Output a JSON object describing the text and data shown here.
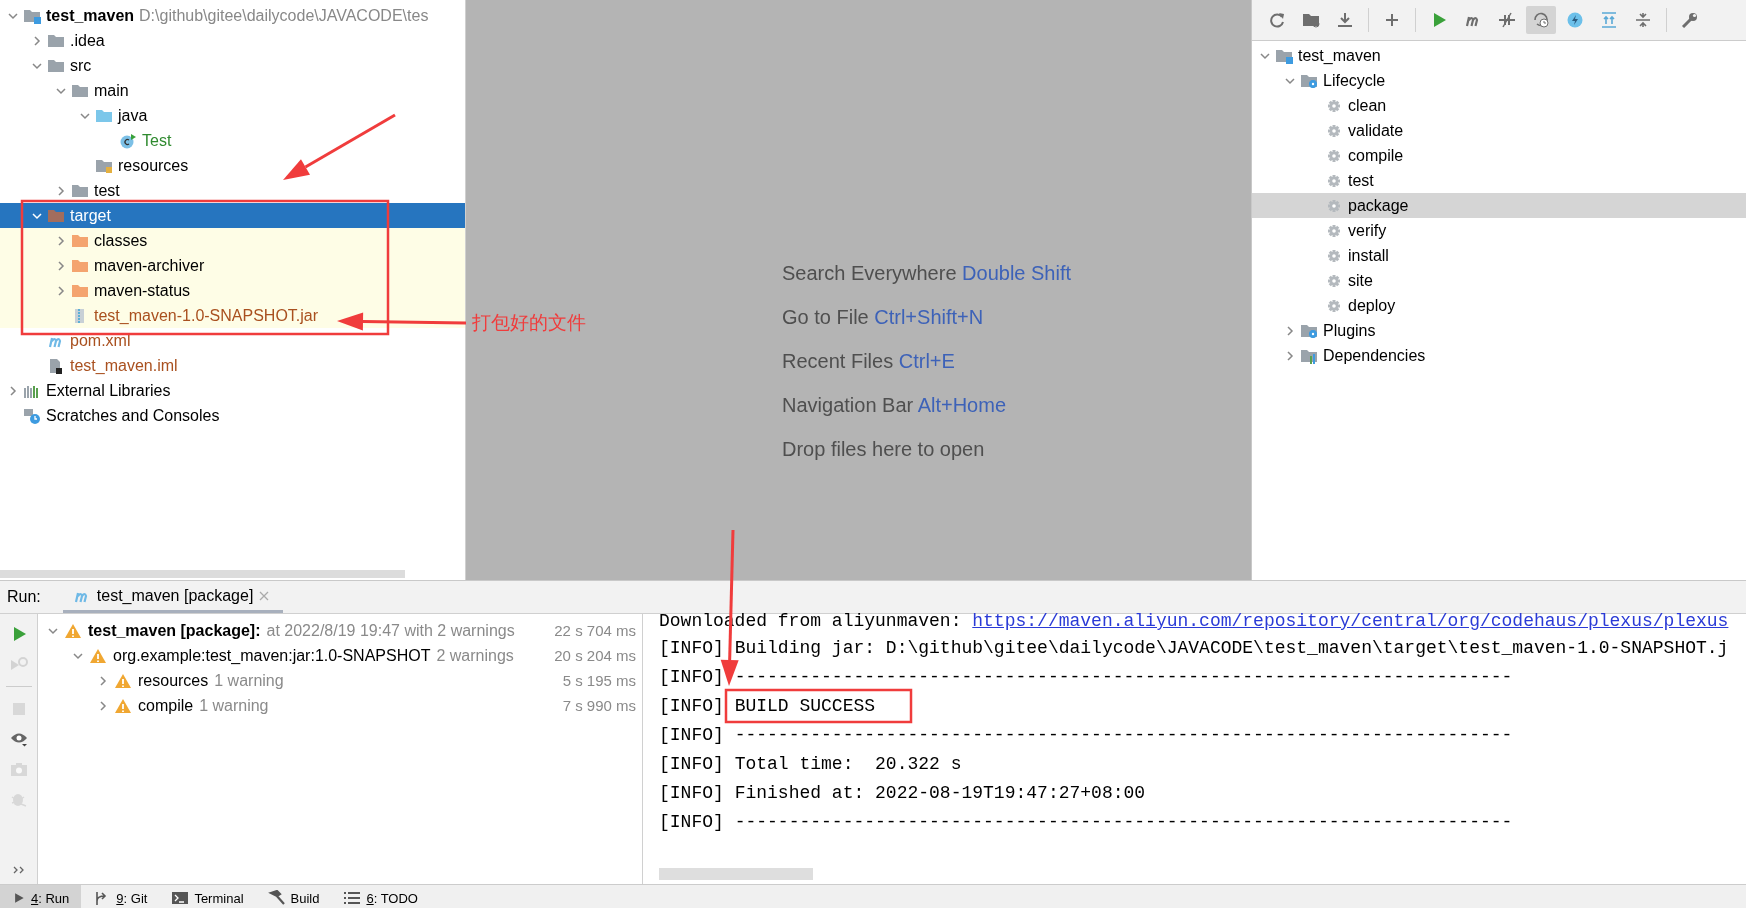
{
  "project_tree": [
    {
      "label": "test_maven",
      "path": "D:\\github\\gitee\\dailycode\\JAVACODE\\tes",
      "kind": "module",
      "expanded": true,
      "selected": false,
      "highlighted": false,
      "children": [
        {
          "label": ".idea",
          "kind": "folder",
          "expanded": false,
          "selected": false,
          "highlighted": false
        },
        {
          "label": "src",
          "kind": "folder",
          "expanded": true,
          "selected": false,
          "highlighted": false,
          "children": [
            {
              "label": "main",
              "kind": "folder",
              "expanded": true,
              "selected": false,
              "highlighted": false,
              "children": [
                {
                  "label": "java",
                  "kind": "source-folder",
                  "expanded": true,
                  "selected": false,
                  "highlighted": false,
                  "children": [
                    {
                      "label": "Test",
                      "kind": "class",
                      "selected": false,
                      "highlighted": false,
                      "color": "#2f8a2f"
                    }
                  ]
                },
                {
                  "label": "resources",
                  "kind": "resources-folder",
                  "selected": false,
                  "highlighted": false
                }
              ]
            },
            {
              "label": "test",
              "kind": "folder",
              "expanded": false,
              "selected": false,
              "highlighted": false
            }
          ]
        },
        {
          "label": "target",
          "kind": "excluded-folder",
          "expanded": true,
          "selected": true,
          "children": [
            {
              "label": "classes",
              "kind": "generated-folder",
              "expanded": false,
              "selected": false,
              "highlighted": true
            },
            {
              "label": "maven-archiver",
              "kind": "generated-folder",
              "expanded": false,
              "selected": false,
              "highlighted": true
            },
            {
              "label": "maven-status",
              "kind": "generated-folder",
              "expanded": false,
              "selected": false,
              "highlighted": true
            },
            {
              "label": "test_maven-1.0-SNAPSHOT.jar",
              "kind": "jar",
              "selected": false,
              "highlighted": true,
              "color": "#a9501f"
            }
          ]
        },
        {
          "label": "pom.xml",
          "kind": "maven-file",
          "selected": false,
          "highlighted": false,
          "color": "#a9501f"
        },
        {
          "label": "test_maven.iml",
          "kind": "module-file",
          "selected": false,
          "highlighted": false,
          "color": "#a9501f"
        }
      ]
    },
    {
      "label": "External Libraries",
      "kind": "libraries",
      "expanded": false,
      "selected": false,
      "highlighted": false
    },
    {
      "label": "Scratches and Consoles",
      "kind": "scratches",
      "selected": false,
      "highlighted": false
    }
  ],
  "annotation": {
    "note": "打包好的文件"
  },
  "welcome_hints": [
    {
      "label": "Search Everywhere",
      "shortcut": "Double Shift"
    },
    {
      "label": "Go to File",
      "shortcut": "Ctrl+Shift+N"
    },
    {
      "label": "Recent Files",
      "shortcut": "Ctrl+E"
    },
    {
      "label": "Navigation Bar",
      "shortcut": "Alt+Home"
    },
    {
      "label": "Drop files here to open"
    }
  ],
  "maven_toolbar": [
    {
      "kind": "reload",
      "on": false
    },
    {
      "kind": "folder-reload",
      "on": false
    },
    {
      "kind": "download",
      "on": false
    },
    {
      "kind": "sep"
    },
    {
      "kind": "add",
      "on": false
    },
    {
      "kind": "sep"
    },
    {
      "kind": "run",
      "on": false
    },
    {
      "kind": "maven",
      "on": false
    },
    {
      "kind": "skip-tests",
      "on": false
    },
    {
      "kind": "history",
      "on": true
    },
    {
      "kind": "lightning",
      "on": false
    },
    {
      "kind": "expand-all",
      "on": false
    },
    {
      "kind": "collapse-all",
      "on": false
    },
    {
      "kind": "sep"
    },
    {
      "kind": "wrench",
      "on": false
    }
  ],
  "maven_tree": [
    {
      "label": "test_maven",
      "kind": "module",
      "expanded": true,
      "selected": false,
      "children": [
        {
          "label": "Lifecycle",
          "kind": "group",
          "expanded": true,
          "selected": false,
          "children": [
            {
              "label": "clean",
              "kind": "goal",
              "selected": false
            },
            {
              "label": "validate",
              "kind": "goal",
              "selected": false
            },
            {
              "label": "compile",
              "kind": "goal",
              "selected": false
            },
            {
              "label": "test",
              "kind": "goal",
              "selected": false
            },
            {
              "label": "package",
              "kind": "goal",
              "selected": true
            },
            {
              "label": "verify",
              "kind": "goal",
              "selected": false
            },
            {
              "label": "install",
              "kind": "goal",
              "selected": false
            },
            {
              "label": "site",
              "kind": "goal",
              "selected": false
            },
            {
              "label": "deploy",
              "kind": "goal",
              "selected": false
            }
          ]
        },
        {
          "label": "Plugins",
          "kind": "group",
          "expanded": false,
          "selected": false
        },
        {
          "label": "Dependencies",
          "kind": "dependencies",
          "expanded": false,
          "selected": false
        }
      ]
    }
  ],
  "run_panel": {
    "label": "Run:",
    "tab": {
      "title": "test_maven [package]",
      "selected": true
    },
    "side_tools": [
      {
        "kind": "run",
        "disabled": false
      },
      {
        "kind": "rerun",
        "disabled": true
      },
      {
        "kind": "sep"
      },
      {
        "kind": "stop",
        "disabled": true
      },
      {
        "kind": "eye",
        "disabled": false
      },
      {
        "kind": "camera",
        "disabled": true
      },
      {
        "kind": "bug",
        "disabled": true
      },
      {
        "kind": "more",
        "disabled": false
      }
    ],
    "tree": [
      {
        "title": "test_maven [package]:",
        "detail": "at 2022/8/19 19:47 with 2 warnings",
        "time": "22 s 704 ms",
        "expanded": true,
        "children": [
          {
            "title": "org.example:test_maven:jar:1.0-SNAPSHOT",
            "detail": "2 warnings",
            "time": "20 s 204 ms",
            "expanded": true,
            "children": [
              {
                "title": "resources",
                "detail": "1 warning",
                "time": "5 s 195 ms",
                "expanded": false
              },
              {
                "title": "compile",
                "detail": "1 warning",
                "time": "7 s 990 ms",
                "expanded": false
              }
            ]
          }
        ]
      }
    ],
    "console": [
      {
        "kind": "link",
        "text": "Downloaded from aliyunmaven: ",
        "link": "https://maven.aliyun.com/repository/central/org/codehaus/plexus/plexus"
      },
      {
        "kind": "log",
        "level": "[INFO]",
        "text": "Building jar: D:\\github\\gitee\\dailycode\\JAVACODE\\test_maven\\target\\test_maven-1.0-SNAPSHOT.j"
      },
      {
        "kind": "log",
        "level": "[INFO]",
        "text": "------------------------------------------------------------------------"
      },
      {
        "kind": "log",
        "level": "[INFO]",
        "text": "BUILD SUCCESS"
      },
      {
        "kind": "log",
        "level": "[INFO]",
        "text": "------------------------------------------------------------------------"
      },
      {
        "kind": "log",
        "level": "[INFO]",
        "text": "Total time:  20.322 s"
      },
      {
        "kind": "log",
        "level": "[INFO]",
        "text": "Finished at: 2022-08-19T19:47:27+08:00"
      },
      {
        "kind": "log",
        "level": "[INFO]",
        "text": "------------------------------------------------------------------------"
      }
    ]
  },
  "tool_window_bar": [
    {
      "kind": "run",
      "mnemonic": "4",
      "label": ": Run",
      "selected": true
    },
    {
      "kind": "git",
      "mnemonic": "9",
      "label": ": Git",
      "selected": false
    },
    {
      "kind": "terminal",
      "label": "Terminal",
      "selected": false
    },
    {
      "kind": "build",
      "label": "Build",
      "selected": false
    },
    {
      "kind": "todo",
      "mnemonic": "6",
      "label": ": TODO",
      "selected": false
    }
  ]
}
